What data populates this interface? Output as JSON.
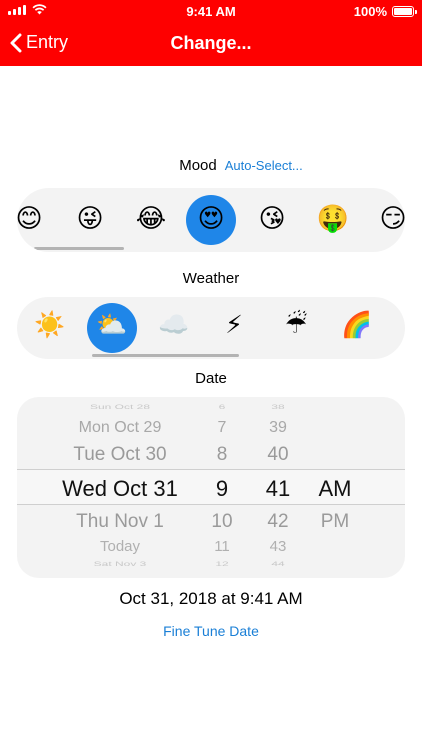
{
  "status": {
    "time": "9:41 AM",
    "battery": "100%"
  },
  "nav": {
    "back_label": "Entry",
    "title": "Change..."
  },
  "mood": {
    "label": "Mood",
    "auto_select": "Auto-Select...",
    "items": [
      {
        "icon": "smiling-face-icon",
        "glyph": "😊"
      },
      {
        "icon": "winking-tongue-face-icon",
        "glyph": "😜"
      },
      {
        "icon": "tears-of-joy-face-icon",
        "glyph": "😂"
      },
      {
        "icon": "heart-eyes-face-icon",
        "glyph": "😍",
        "selected": true
      },
      {
        "icon": "kissing-heart-face-icon",
        "glyph": "😘"
      },
      {
        "icon": "money-mouth-face-icon",
        "glyph": "🤑"
      },
      {
        "icon": "smirking-face-icon",
        "glyph": "😏"
      }
    ]
  },
  "weather": {
    "label": "Weather",
    "items": [
      {
        "icon": "sun-icon",
        "glyph": "☀️"
      },
      {
        "icon": "sun-behind-cloud-icon",
        "glyph": "⛅",
        "selected": true
      },
      {
        "icon": "cloud-icon",
        "glyph": "☁️"
      },
      {
        "icon": "lightning-icon",
        "glyph": "⚡"
      },
      {
        "icon": "umbrella-rain-icon",
        "glyph": "☔"
      },
      {
        "icon": "rainbow-icon",
        "glyph": "🌈"
      }
    ]
  },
  "date": {
    "label": "Date",
    "picker": {
      "days": [
        "Sun Oct 28",
        "Mon Oct 29",
        "Tue Oct 30",
        "Wed Oct 31",
        "Thu Nov 1",
        "Today",
        "Sat Nov 3"
      ],
      "hours": [
        "6",
        "7",
        "8",
        "9",
        "10",
        "11",
        "12"
      ],
      "minutes": [
        "38",
        "39",
        "40",
        "41",
        "42",
        "43",
        "44"
      ],
      "periods": [
        "",
        "",
        "",
        "AM",
        "PM",
        "",
        ""
      ],
      "selected_day": "Wed Oct 31",
      "selected_hour": "9",
      "selected_minute": "41",
      "selected_period": "AM"
    },
    "summary": "Oct 31, 2018 at 9:41 AM",
    "fine_tune": "Fine Tune Date"
  },
  "colors": {
    "accent": "#fe0000",
    "selection": "#1f86e8",
    "link": "#1a7fd6"
  }
}
